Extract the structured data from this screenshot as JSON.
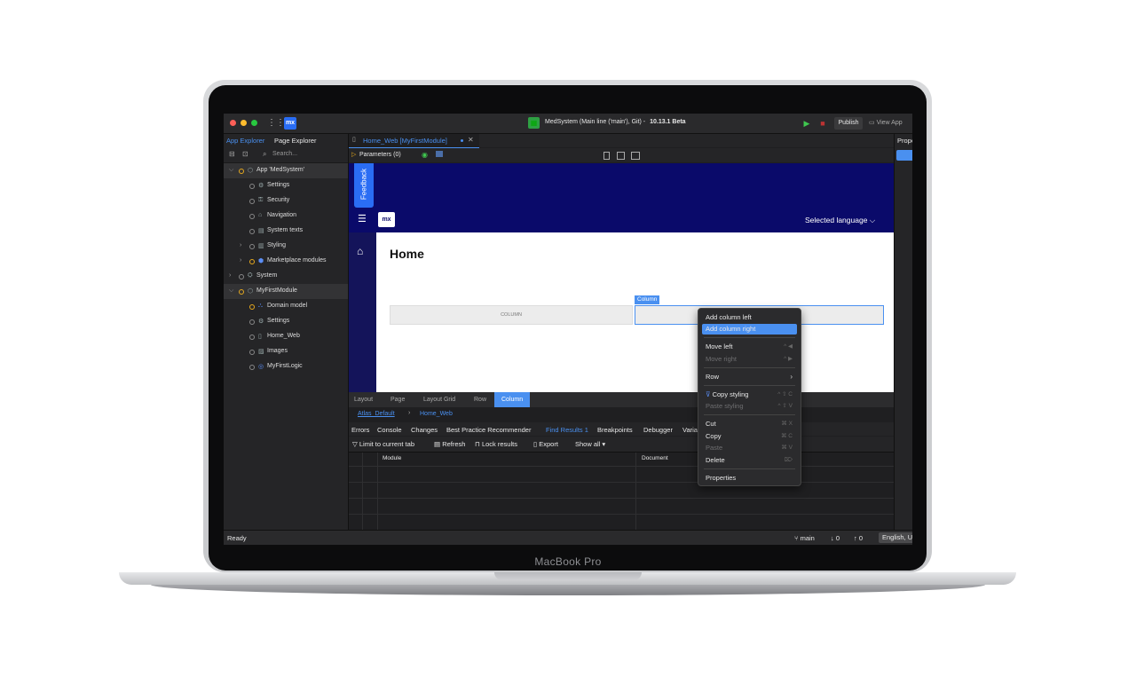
{
  "device": {
    "label": "MacBook Pro"
  },
  "titlebar": {
    "app_title": "MedSystem (Main line ('main'), Git)  -",
    "version": "10.13.1 Beta",
    "publish_label": "Publish",
    "view_app_label": "View App",
    "logo": "mx"
  },
  "explorer": {
    "tabs": [
      "App Explorer",
      "Page Explorer"
    ],
    "search_placeholder": "Search...",
    "tree": [
      {
        "label": "App 'MedSystem'",
        "level": 0,
        "chevron": "⌵",
        "icon": "cube-icon"
      },
      {
        "label": "Settings",
        "level": 1,
        "icon": "gear-icon"
      },
      {
        "label": "Security",
        "level": 1,
        "icon": "key-icon"
      },
      {
        "label": "Navigation",
        "level": 1,
        "icon": "home-icon"
      },
      {
        "label": "System texts",
        "level": 1,
        "icon": "text-icon"
      },
      {
        "label": "Styling",
        "level": 1,
        "chevron": "›",
        "icon": "styling-icon"
      },
      {
        "label": "Marketplace modules",
        "level": 1,
        "chevron": "›",
        "icon": "package-icon"
      },
      {
        "label": "System",
        "level": 0,
        "chevron": "›",
        "icon": "system-icon"
      },
      {
        "label": "MyFirstModule",
        "level": 0,
        "chevron": "⌵",
        "icon": "module-icon"
      },
      {
        "label": "Domain model",
        "level": 1,
        "icon": "domain-model-icon"
      },
      {
        "label": "Settings",
        "level": 1,
        "icon": "gear-icon"
      },
      {
        "label": "Home_Web",
        "level": 1,
        "icon": "page-icon"
      },
      {
        "label": "Images",
        "level": 1,
        "icon": "image-icon"
      },
      {
        "label": "MyFirstLogic",
        "level": 1,
        "icon": "logic-icon"
      }
    ]
  },
  "document": {
    "tab_label": "Home_Web [MyFirstModule]",
    "parameters_label": "Parameters (0)"
  },
  "canvas": {
    "feedback_label": "Feedback",
    "logo": "mx",
    "language_label": "Selected language  ⌵",
    "page_heading": "Home",
    "column_left_label": "COLUMN",
    "column_tag": "Column"
  },
  "breadcrumb": {
    "items": [
      "Layout",
      "Page",
      "Layout Grid",
      "Row",
      "Column"
    ],
    "sub_layout": "Atlas_Default",
    "sub_page": "Home_Web"
  },
  "bottom_panel": {
    "tabs": [
      "Errors",
      "Console",
      "Changes",
      "Best Practice Recommender",
      "Find Results 1",
      "Breakpoints",
      "Debugger",
      "Varia"
    ],
    "toolbar": {
      "limit": "Limit to current tab",
      "refresh": "Refresh",
      "lock": "Lock results",
      "export": "Export",
      "show_all": "Show all ▾"
    },
    "columns": [
      "Module",
      "Document"
    ]
  },
  "properties": {
    "title": "Properties"
  },
  "statusbar": {
    "status": "Ready",
    "branch": "main",
    "down": "0",
    "up": "0",
    "language": "English, United States"
  },
  "context_menu": {
    "add_left": "Add column left",
    "add_right": "Add column right",
    "move_left": "Move left",
    "move_left_sc": "^ ◀",
    "move_right": "Move right",
    "move_right_sc": "^ ▶",
    "row": "Row",
    "copy_styling": "Copy styling",
    "copy_styling_sc": "^ ⇧ C",
    "paste_styling": "Paste styling",
    "paste_styling_sc": "^ ⇧ V",
    "cut": "Cut",
    "cut_sc": "⌘ X",
    "copy": "Copy",
    "copy_sc": "⌘ C",
    "paste": "Paste",
    "paste_sc": "⌘ V",
    "delete": "Delete",
    "delete_sc": "⌦",
    "properties": "Properties"
  }
}
